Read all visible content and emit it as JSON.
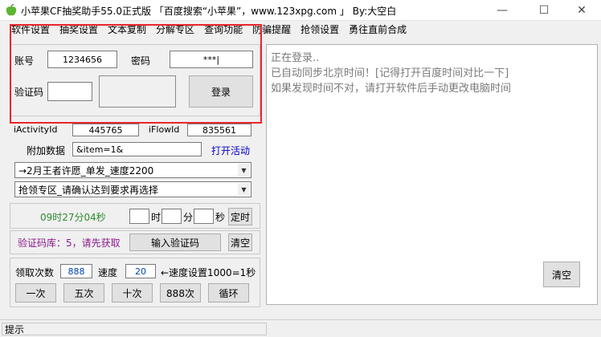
{
  "window": {
    "title": "小苹果CF抽奖助手55.0正式版 「百度搜索“小苹果”，www.123xpg.com 」 By:大空白",
    "min_glyph": "—",
    "max_glyph": "☐",
    "close_glyph": "✕"
  },
  "menu": [
    "软件设置",
    "抽奖设置",
    "文本复制",
    "分解专区",
    "查询功能",
    "防骗提醒",
    "抢领设置",
    "勇往直前合成"
  ],
  "login": {
    "account_label": "账号",
    "account_value": "1234656",
    "password_label": "密码",
    "password_value": "***|",
    "captcha_label": "验证码",
    "captcha_value": "",
    "login_button": "登录"
  },
  "params": {
    "activity_label": "iActivityId",
    "activity_value": "445765",
    "flow_label": "iFlowId",
    "flow_value": "835561",
    "extra_label": "附加数据",
    "extra_value": "&item=1&",
    "open_link": "打开活动"
  },
  "dropdowns": {
    "activity_select": "→2月王者许愿_单发_速度2200",
    "claim_select": "抢领专区_请确认达到要求再选择"
  },
  "timer": {
    "countdown": "09时27分04秒",
    "hour_value": "",
    "hour_label": "时",
    "minute_value": "",
    "minute_label": "分",
    "second_value": "",
    "second_label": "秒",
    "set_button": "定时"
  },
  "captcha_lib": {
    "status": "验证码库：5，请先获取",
    "input_button": "输入验证码",
    "clear_button": "清空"
  },
  "draw": {
    "count_label": "领取次数",
    "count_value": "888",
    "speed_label": "速度",
    "speed_value": "20",
    "speed_hint": "←速度设置1000=1秒",
    "buttons": [
      "一次",
      "五次",
      "十次",
      "888次",
      "循环"
    ]
  },
  "log": {
    "lines": [
      "正在登录..",
      "已自动同步北京时间！[记得打开百度时间对比一下]",
      "如果发现时间不对，请打开软件后手动更改电脑时间"
    ],
    "clear_button": "清空"
  },
  "status_bar": {
    "text": "提示"
  },
  "colors": {
    "highlight_box": "#e8262b",
    "link": "#0000cc",
    "countdown": "#2e8b2e",
    "captcha_status": "#8b1a8b",
    "log_text": "#7a7a7a"
  }
}
